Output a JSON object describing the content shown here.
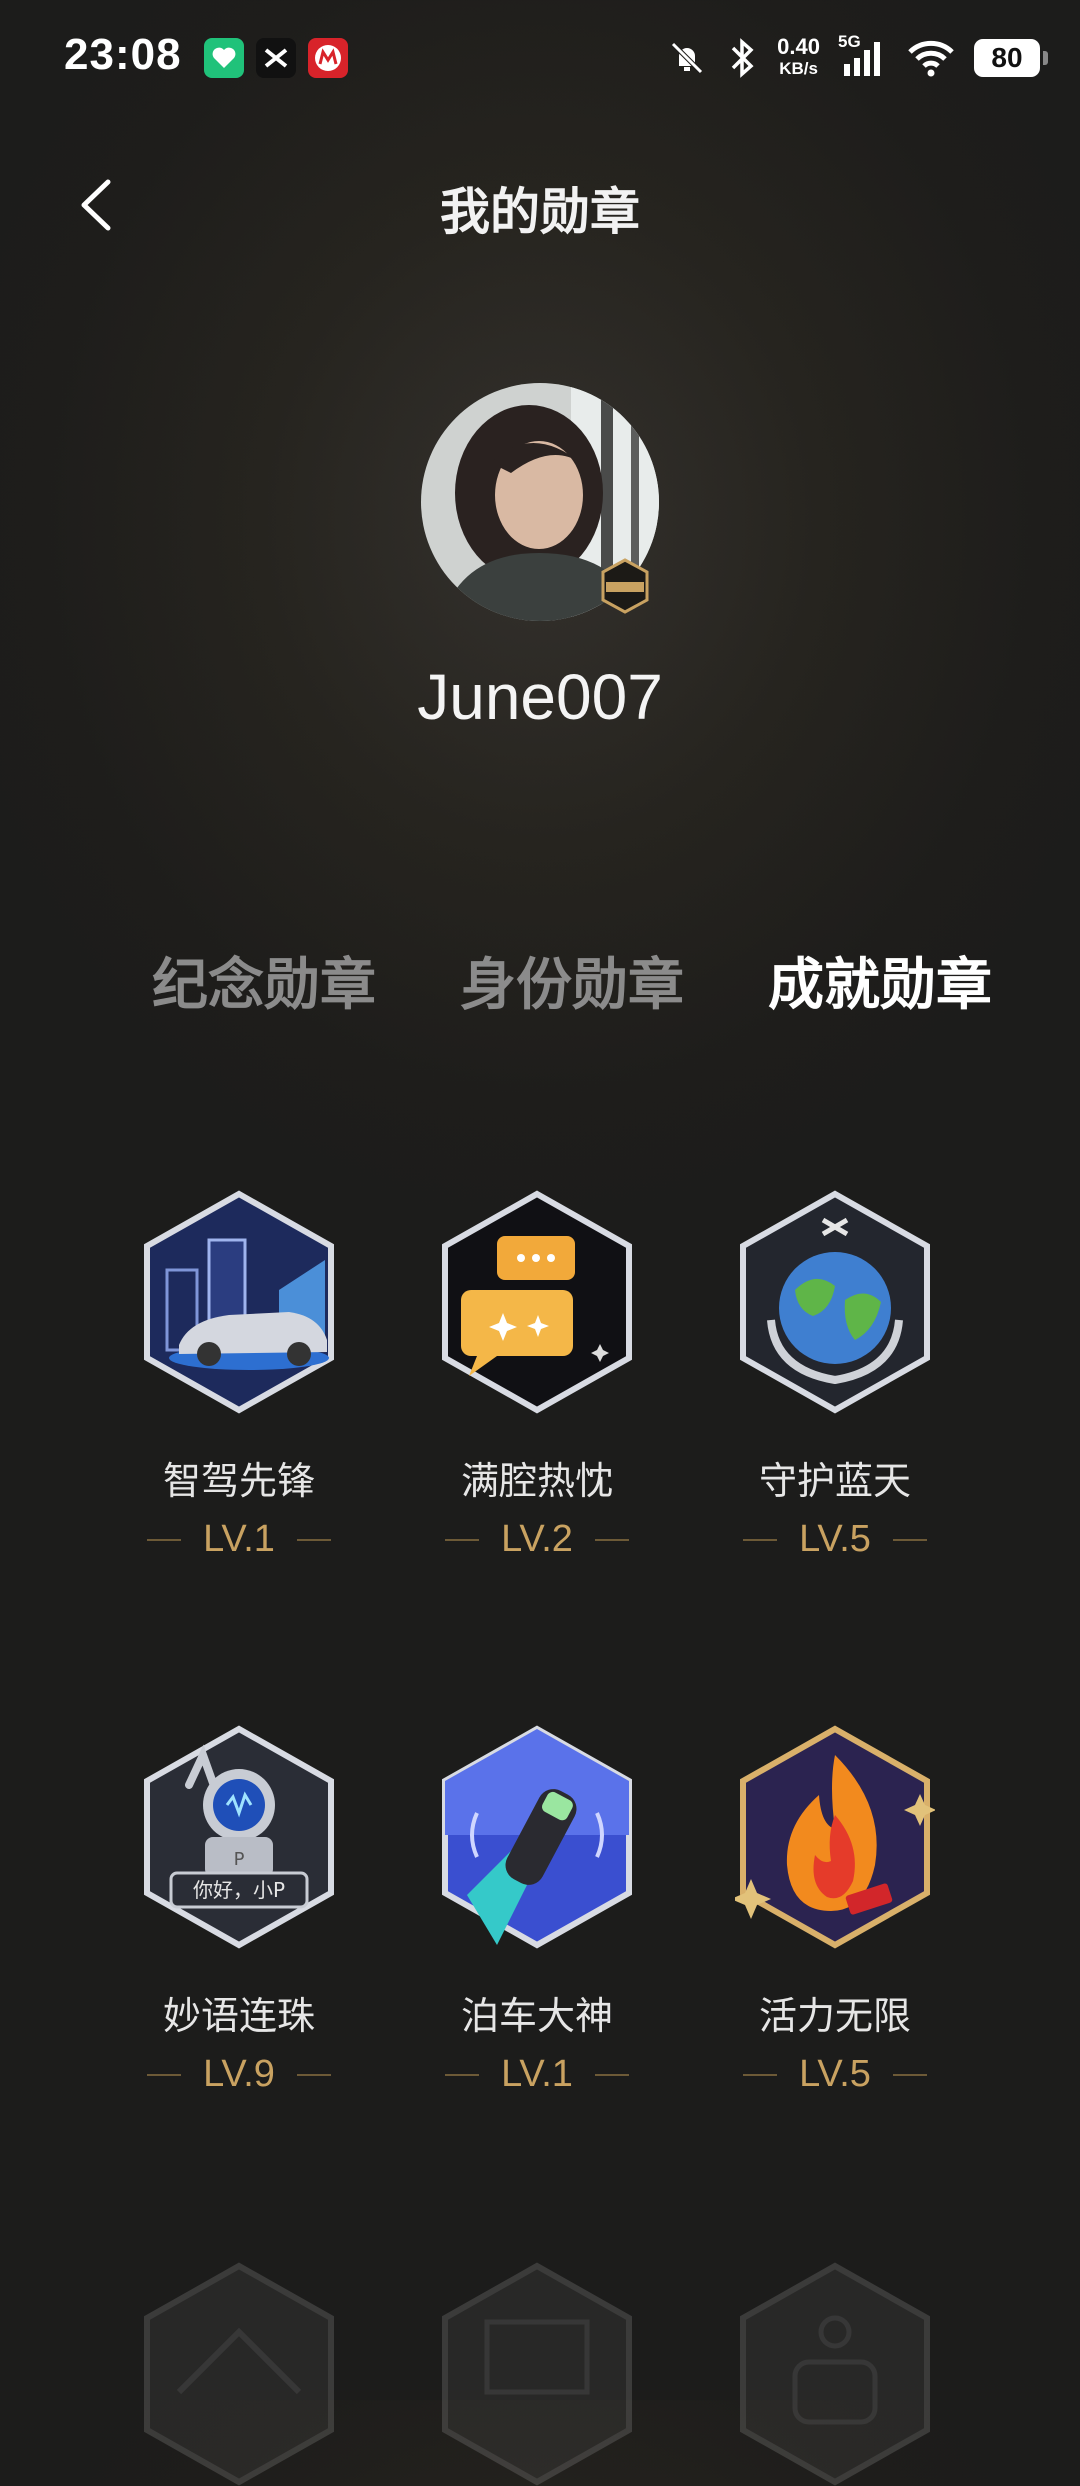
{
  "status_bar": {
    "time": "23:08",
    "net_speed_value": "0.40",
    "net_speed_unit": "KB/s",
    "network_type": "5G",
    "battery": "80",
    "icons": [
      "app-green-heart-icon",
      "app-x-icon",
      "app-red-m-icon",
      "mute-bell-icon",
      "bluetooth-icon",
      "signal-icon",
      "wifi-icon"
    ]
  },
  "header": {
    "title": "我的勋章"
  },
  "profile": {
    "username": "June007"
  },
  "tabs": [
    {
      "label": "纪念勋章",
      "active": false
    },
    {
      "label": "身份勋章",
      "active": false
    },
    {
      "label": "成就勋章",
      "active": true
    }
  ],
  "medals": [
    {
      "name": "智驾先锋",
      "level": "LV.1",
      "icon": "car-city-badge-icon"
    },
    {
      "name": "满腔热忱",
      "level": "LV.2",
      "icon": "chat-bubbles-badge-icon"
    },
    {
      "name": "守护蓝天",
      "level": "LV.5",
      "icon": "globe-hands-badge-icon"
    },
    {
      "name": "妙语连珠",
      "level": "LV.9",
      "icon": "astronaut-voice-badge-icon"
    },
    {
      "name": "泊车大神",
      "level": "LV.1",
      "icon": "parking-car-badge-icon"
    },
    {
      "name": "活力无限",
      "level": "LV.5",
      "icon": "fire-badge-icon"
    }
  ],
  "medal_texts": {
    "astronaut_speech": "你好，小P",
    "astronaut_chest": "P"
  },
  "colors": {
    "level_gold": "#c9a261",
    "active_tab": "#ffffff",
    "inactive_tab": "#8b8b8b"
  }
}
